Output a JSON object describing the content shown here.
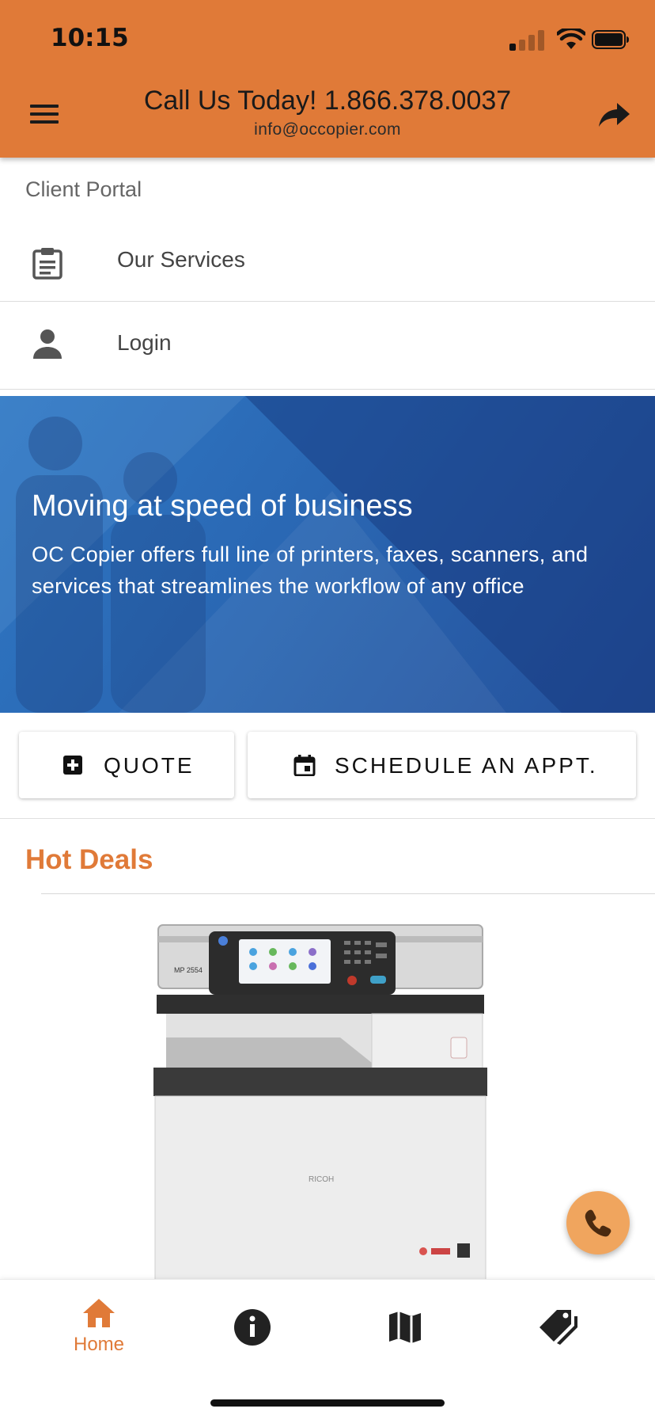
{
  "status_bar": {
    "time": "10:15",
    "icons": [
      "signal-icon",
      "wifi-icon",
      "battery-icon"
    ]
  },
  "header": {
    "title": "Call Us Today! 1.866.378.0037",
    "email": "info@occopier.com",
    "menu_icon": "hamburger-menu-icon",
    "share_icon": "share-arrow-icon"
  },
  "portal": {
    "label": "Client Portal",
    "items": [
      {
        "label": "Our Services",
        "icon": "clipboard-icon"
      },
      {
        "label": "Login",
        "icon": "person-icon"
      }
    ]
  },
  "hero": {
    "title": "Moving at speed of business",
    "text": "OC Copier offers full line of printers, faxes, scanners, and services that streamlines the workflow of any office"
  },
  "actions": {
    "quote_label": "QUOTE",
    "schedule_label": "SCHEDULE AN APPT."
  },
  "hot_deals": {
    "title": "Hot Deals"
  },
  "product_image_text": {
    "brand": "RICOH",
    "model": "MP 2554"
  },
  "bottom_nav": {
    "items": [
      {
        "label": "Home",
        "icon": "home-icon",
        "active": true
      },
      {
        "label": "",
        "icon": "info-icon",
        "active": false
      },
      {
        "label": "",
        "icon": "map-icon",
        "active": false
      },
      {
        "label": "",
        "icon": "tag-icon",
        "active": false
      }
    ]
  },
  "colors": {
    "accent": "#e07a38",
    "fab": "#f0a55e",
    "hero": "#2a67b3",
    "nav_inactive": "#222222"
  }
}
